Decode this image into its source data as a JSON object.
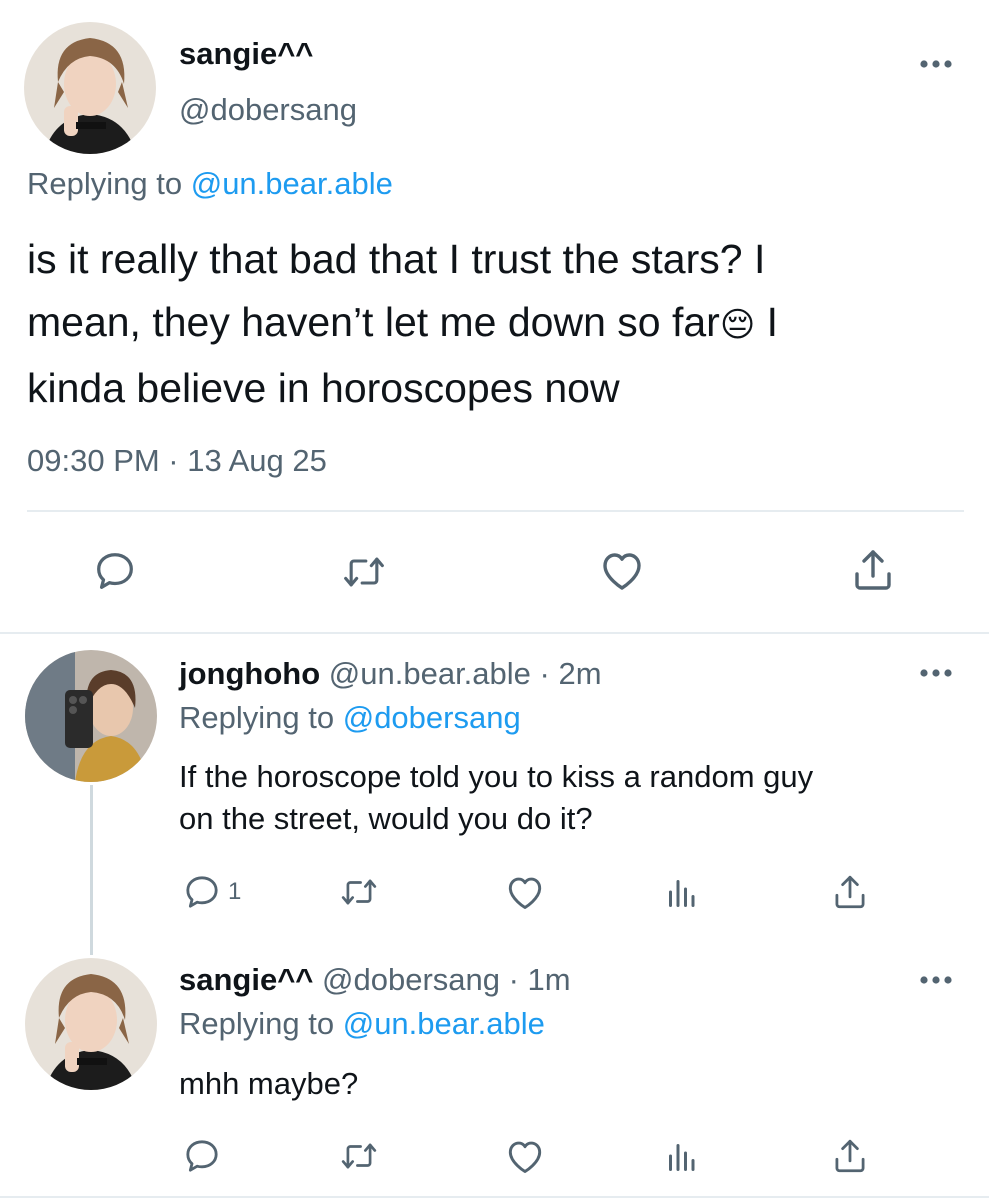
{
  "main_tweet": {
    "display_name": "sangie^^",
    "handle": "@dobersang",
    "replying_prefix": "Replying to ",
    "replying_to": "@un.bear.able",
    "text_line1": "is it really that bad that I trust the stars? I",
    "text_line2a": "mean, they haven’t let me down so far",
    "text_emoji": "😔",
    "text_line2b": " I",
    "text_line3": "kinda believe in horoscopes now",
    "timestamp": "09:30 PM · 13 Aug 25",
    "actions": [
      "reply-icon",
      "retweet-icon",
      "like-icon",
      "share-icon"
    ]
  },
  "reply1": {
    "display_name": "jonghoho",
    "handle_time": " @un.bear.able · 2m",
    "replying_prefix": "Replying to ",
    "replying_to": "@dobersang",
    "text_line1": "If the horoscope told you to kiss a random guy",
    "text_line2": "on the street, would you do it?",
    "reply_count": "1",
    "actions": [
      "reply-icon",
      "retweet-icon",
      "like-icon",
      "analytics-icon",
      "share-icon"
    ]
  },
  "reply2": {
    "display_name": "sangie^^",
    "handle_time": " @dobersang · 1m",
    "replying_prefix": "Replying to ",
    "replying_to": "@un.bear.able",
    "text": "mhh maybe?",
    "actions": [
      "reply-icon",
      "retweet-icon",
      "like-icon",
      "analytics-icon",
      "share-icon"
    ]
  },
  "colors": {
    "text": "#0f1419",
    "secondary": "#536471",
    "link": "#1d9bf0",
    "divider": "#e6ecf0"
  }
}
